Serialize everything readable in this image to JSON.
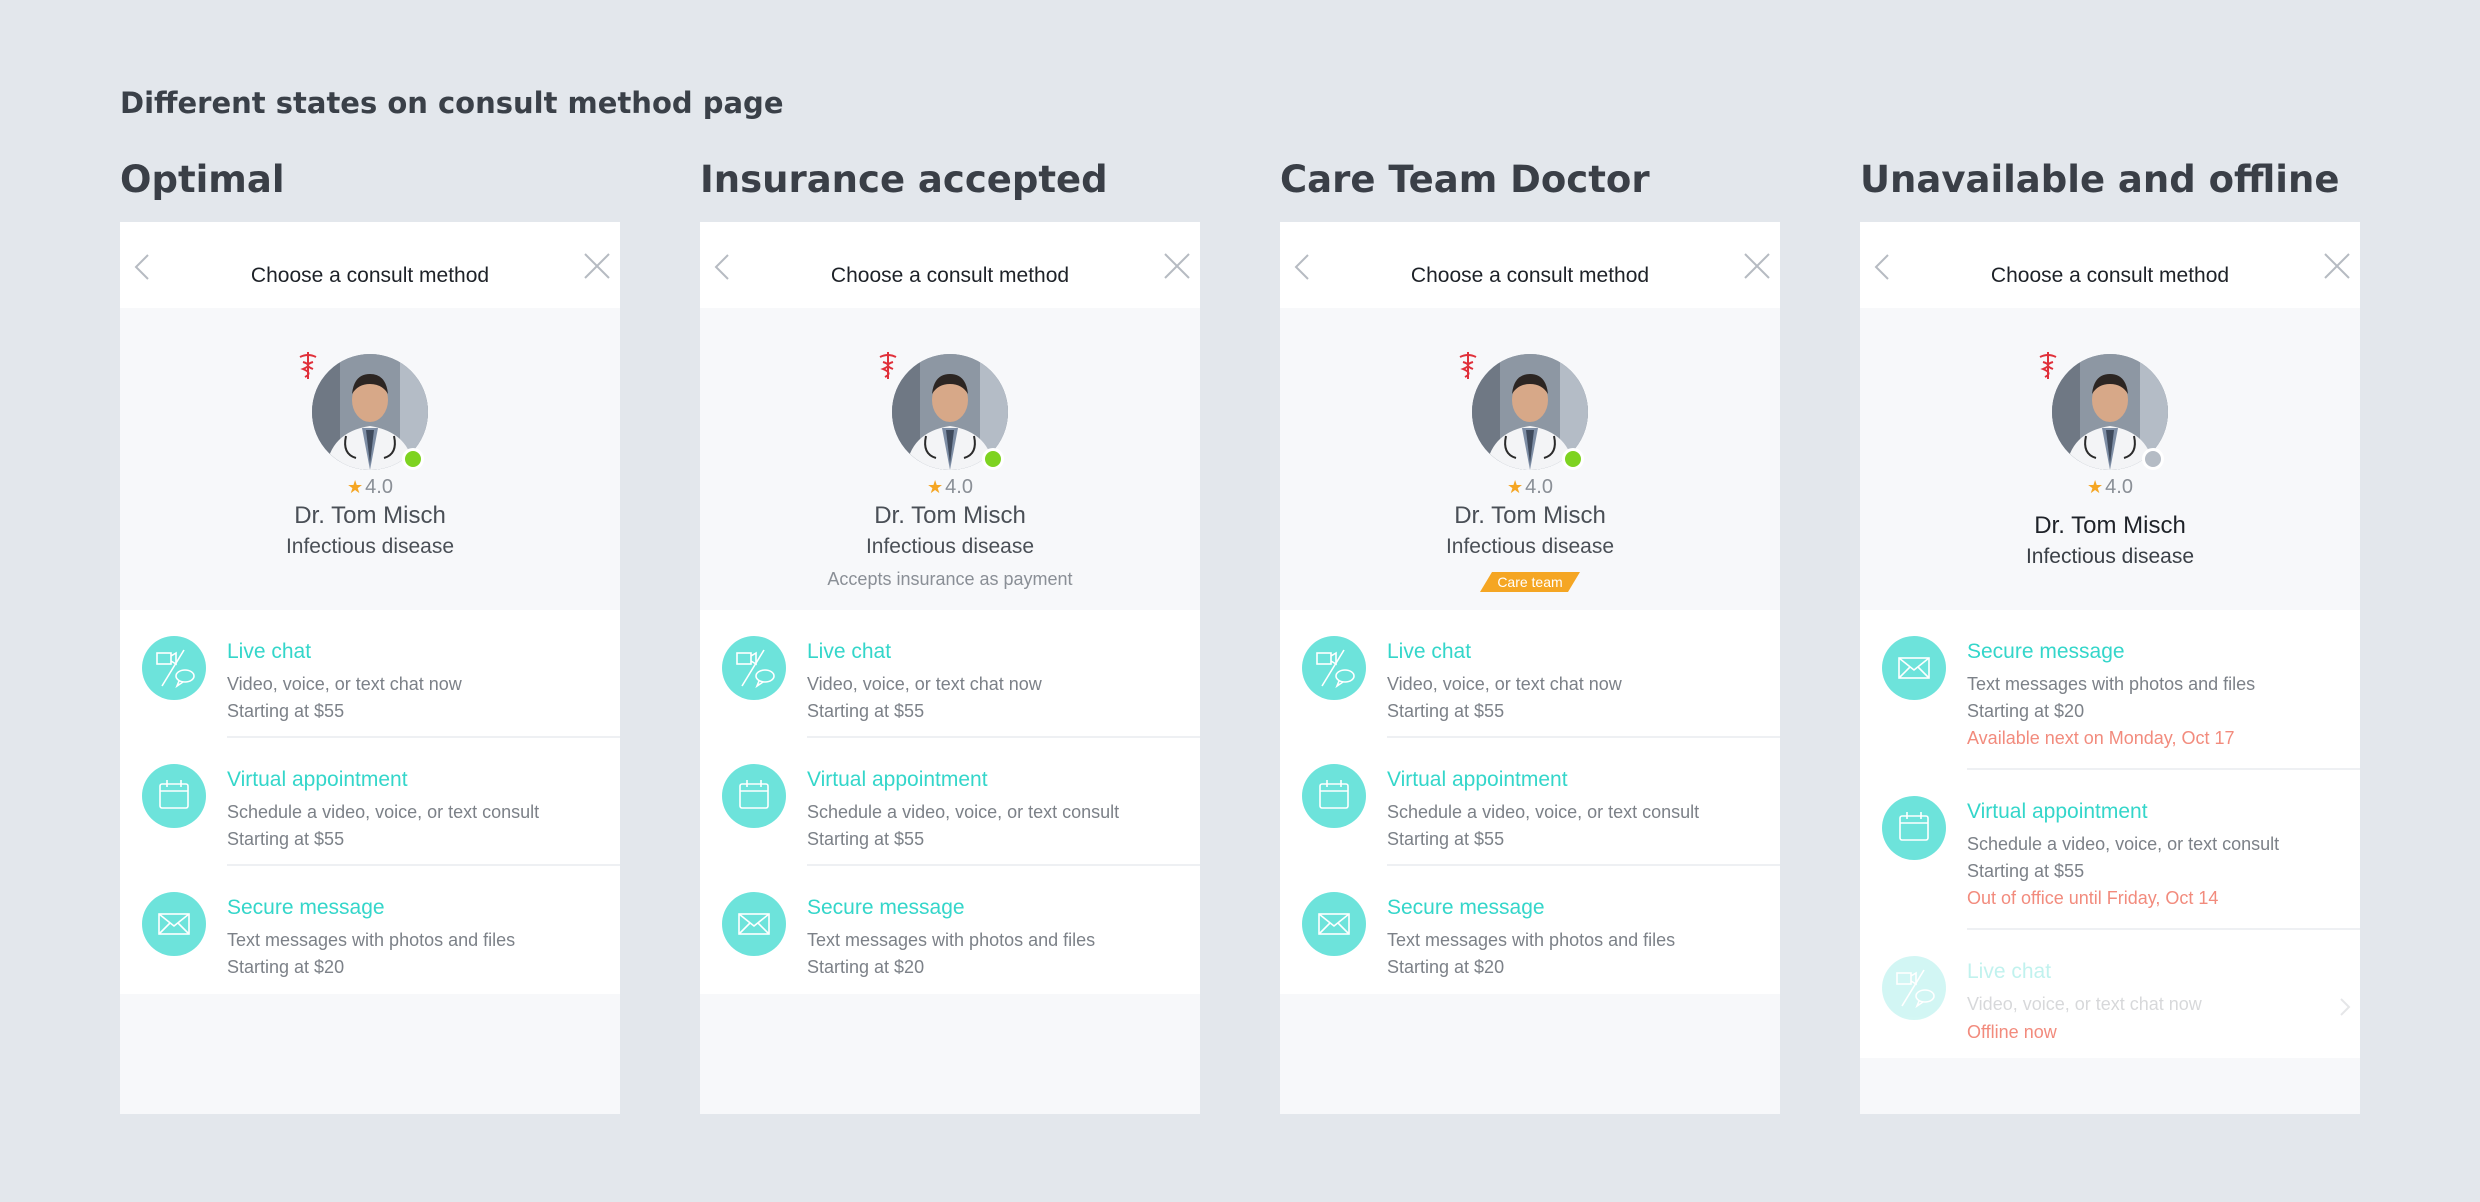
{
  "heading": "Different states on consult method page",
  "colors": {
    "background": "#e3e7ec",
    "accent": "#34d6ca",
    "icon_fill": "#6de3db",
    "online": "#7ed321",
    "offline": "#b5bcc5",
    "star": "#f5a623",
    "badge": "#f5a623",
    "warning": "#f28b7d"
  },
  "screens": [
    {
      "state_title": "Optimal",
      "header_title": "Choose a consult method",
      "doctor": {
        "rating": "4.0",
        "name": "Dr. Tom Misch",
        "specialty": "Infectious disease",
        "status": "online"
      },
      "options": [
        {
          "icon": "chat-icon",
          "title": "Live chat",
          "desc": "Video, voice, or text chat now",
          "price": "Starting at $55"
        },
        {
          "icon": "calendar-icon",
          "title": "Virtual appointment",
          "desc": "Schedule a video, voice, or text consult",
          "price": "Starting at $55"
        },
        {
          "icon": "envelope-icon",
          "title": "Secure message",
          "desc": "Text messages with photos and files",
          "price": "Starting at $20"
        }
      ]
    },
    {
      "state_title": "Insurance accepted",
      "header_title": "Choose a consult method",
      "doctor": {
        "rating": "4.0",
        "name": "Dr. Tom Misch",
        "specialty": "Infectious disease",
        "extra": "Accepts insurance as payment",
        "status": "online"
      },
      "options": [
        {
          "icon": "chat-icon",
          "title": "Live chat",
          "desc": "Video, voice, or text chat now",
          "price": "Starting at $55"
        },
        {
          "icon": "calendar-icon",
          "title": "Virtual appointment",
          "desc": "Schedule a video, voice, or text consult",
          "price": "Starting at $55"
        },
        {
          "icon": "envelope-icon",
          "title": "Secure message",
          "desc": "Text messages with photos and files",
          "price": "Starting at $20"
        }
      ]
    },
    {
      "state_title": "Care Team Doctor",
      "header_title": "Choose a consult method",
      "doctor": {
        "rating": "4.0",
        "name": "Dr. Tom Misch",
        "specialty": "Infectious disease",
        "badge": "Care team",
        "status": "online"
      },
      "options": [
        {
          "icon": "chat-icon",
          "title": "Live chat",
          "desc": "Video, voice, or text chat now",
          "price": "Starting at $55"
        },
        {
          "icon": "calendar-icon",
          "title": "Virtual appointment",
          "desc": "Schedule a video, voice, or text consult",
          "price": "Starting at $55"
        },
        {
          "icon": "envelope-icon",
          "title": "Secure message",
          "desc": "Text messages with photos and files",
          "price": "Starting at $20"
        }
      ]
    },
    {
      "state_title": "Unavailable and offline",
      "header_title": "Choose a consult method",
      "doctor": {
        "rating": "4.0",
        "name": "Dr. Tom Misch",
        "specialty": "Infectious disease",
        "status": "offline"
      },
      "options": [
        {
          "icon": "envelope-icon",
          "title": "Secure message",
          "desc": "Text messages with photos and files",
          "price": "Starting at $20",
          "note": "Available next on Monday, Oct 17"
        },
        {
          "icon": "calendar-icon",
          "title": "Virtual appointment",
          "desc": "Schedule a video, voice, or text consult",
          "price": "Starting at $55",
          "note": "Out of office until Friday, Oct 14"
        },
        {
          "icon": "chat-icon",
          "title": "Live chat",
          "desc": "Video, voice, or text chat now",
          "note": "Offline now",
          "disabled": true
        }
      ]
    }
  ]
}
